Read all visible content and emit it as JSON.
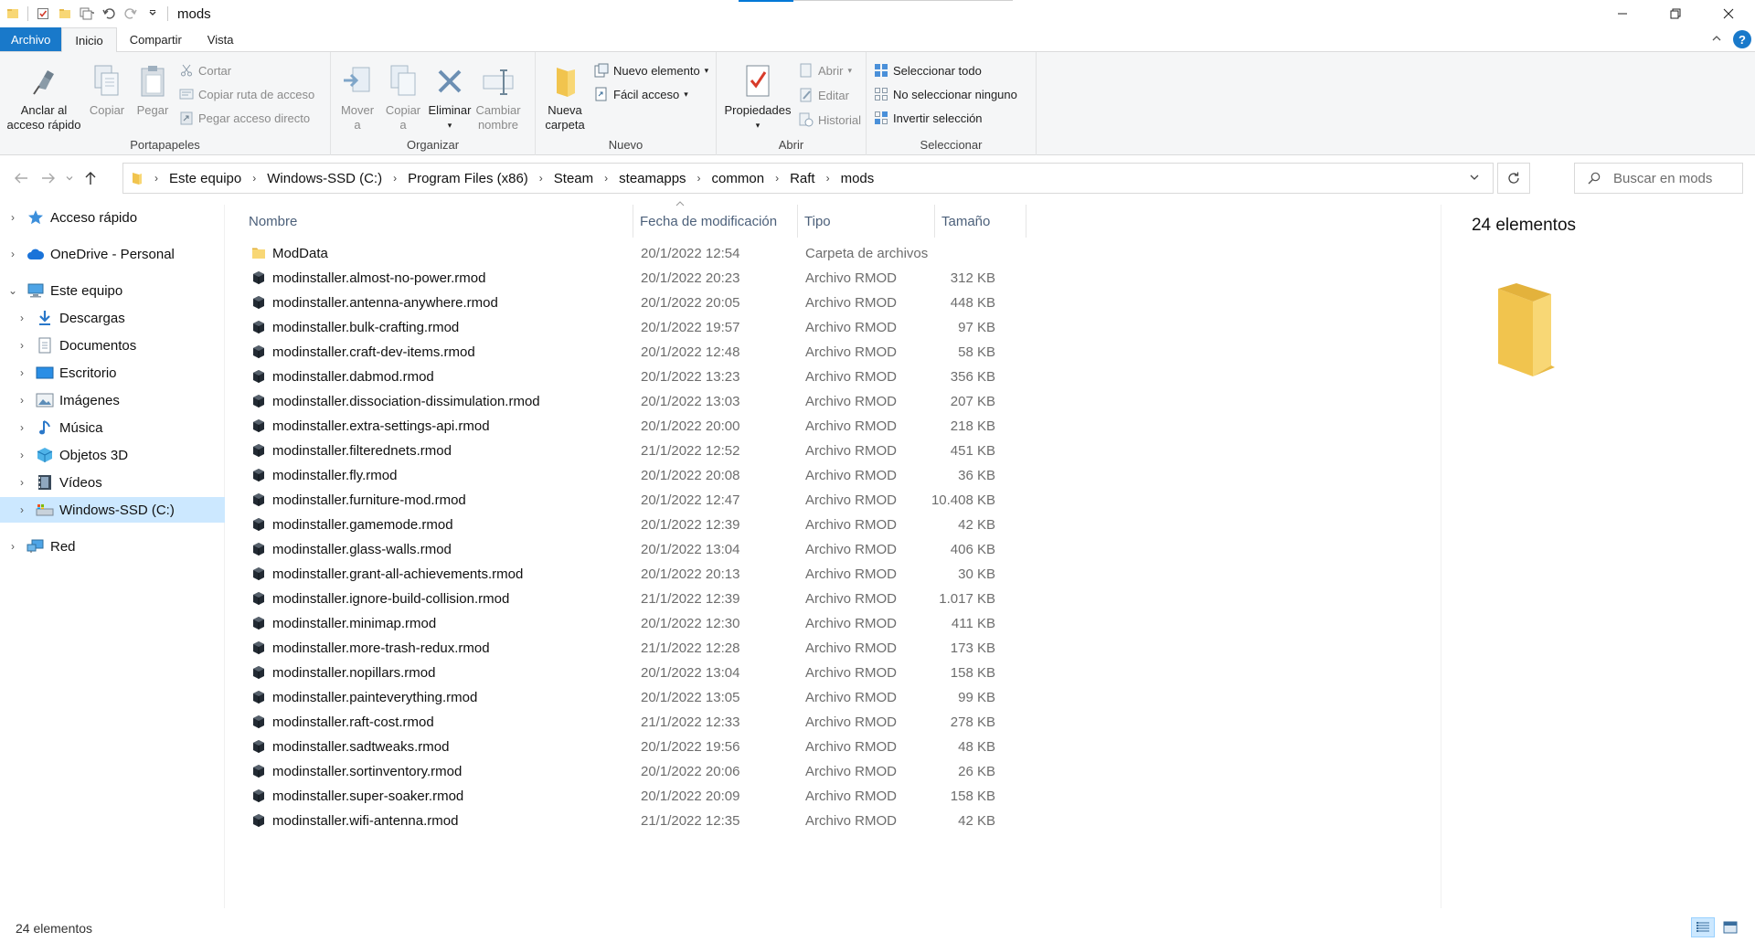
{
  "window": {
    "title": "mods",
    "controls": [
      "minimize-icon",
      "restore-icon",
      "close-icon"
    ]
  },
  "tabs": {
    "file": "Archivo",
    "home": "Inicio",
    "share": "Compartir",
    "view": "Vista"
  },
  "ribbon": {
    "portapapeles": {
      "label": "Portapapeles",
      "pin": "Anclar al acceso rápido",
      "pin_line1": "Anclar al",
      "pin_line2": "acceso rápido",
      "copy": "Copiar",
      "paste": "Pegar",
      "cut": "Cortar",
      "copy_path": "Copiar ruta de acceso",
      "paste_shortcut": "Pegar acceso directo"
    },
    "organizar": {
      "label": "Organizar",
      "move_line1": "Mover",
      "move_line2": "a",
      "copy_line1": "Copiar",
      "copy_line2": "a",
      "delete": "Eliminar",
      "rename_line1": "Cambiar",
      "rename_line2": "nombre"
    },
    "nuevo": {
      "label": "Nuevo",
      "new_folder_line1": "Nueva",
      "new_folder_line2": "carpeta",
      "new_item": "Nuevo elemento",
      "easy_access": "Fácil acceso"
    },
    "abrir": {
      "label": "Abrir",
      "properties": "Propiedades",
      "open": "Abrir",
      "edit": "Editar",
      "history": "Historial"
    },
    "seleccionar": {
      "label": "Seleccionar",
      "select_all": "Seleccionar todo",
      "select_none": "No seleccionar ninguno",
      "invert": "Invertir selección"
    }
  },
  "address": {
    "crumbs": [
      "Este equipo",
      "Windows-SSD (C:)",
      "Program Files (x86)",
      "Steam",
      "steamapps",
      "common",
      "Raft",
      "mods"
    ],
    "search_placeholder": "Buscar en mods"
  },
  "nav": {
    "items": [
      {
        "label": "Acceso rápido",
        "icon": "star-icon"
      },
      {
        "label": "OneDrive - Personal",
        "icon": "cloud-icon"
      },
      {
        "label": "Este equipo",
        "icon": "computer-icon"
      },
      {
        "label": "Descargas",
        "icon": "download-icon"
      },
      {
        "label": "Documentos",
        "icon": "document-icon"
      },
      {
        "label": "Escritorio",
        "icon": "desktop-icon"
      },
      {
        "label": "Imágenes",
        "icon": "images-icon"
      },
      {
        "label": "Música",
        "icon": "music-icon"
      },
      {
        "label": "Objetos 3D",
        "icon": "cube-icon"
      },
      {
        "label": "Vídeos",
        "icon": "video-icon"
      },
      {
        "label": "Windows-SSD (C:)",
        "icon": "drive-icon"
      },
      {
        "label": "Red",
        "icon": "network-icon"
      }
    ]
  },
  "columns": {
    "name": "Nombre",
    "date": "Fecha de modificación",
    "type": "Tipo",
    "size": "Tamaño"
  },
  "files": [
    {
      "name": "ModData",
      "date": "20/1/2022 12:54",
      "type": "Carpeta de archivos",
      "size": "",
      "icon": "folder-icon"
    },
    {
      "name": "modinstaller.almost-no-power.rmod",
      "date": "20/1/2022 20:23",
      "type": "Archivo RMOD",
      "size": "312 KB",
      "icon": "rmod-file-icon"
    },
    {
      "name": "modinstaller.antenna-anywhere.rmod",
      "date": "20/1/2022 20:05",
      "type": "Archivo RMOD",
      "size": "448 KB",
      "icon": "rmod-file-icon"
    },
    {
      "name": "modinstaller.bulk-crafting.rmod",
      "date": "20/1/2022 19:57",
      "type": "Archivo RMOD",
      "size": "97 KB",
      "icon": "rmod-file-icon"
    },
    {
      "name": "modinstaller.craft-dev-items.rmod",
      "date": "20/1/2022 12:48",
      "type": "Archivo RMOD",
      "size": "58 KB",
      "icon": "rmod-file-icon"
    },
    {
      "name": "modinstaller.dabmod.rmod",
      "date": "20/1/2022 13:23",
      "type": "Archivo RMOD",
      "size": "356 KB",
      "icon": "rmod-file-icon"
    },
    {
      "name": "modinstaller.dissociation-dissimulation.rmod",
      "date": "20/1/2022 13:03",
      "type": "Archivo RMOD",
      "size": "207 KB",
      "icon": "rmod-file-icon"
    },
    {
      "name": "modinstaller.extra-settings-api.rmod",
      "date": "20/1/2022 20:00",
      "type": "Archivo RMOD",
      "size": "218 KB",
      "icon": "rmod-file-icon"
    },
    {
      "name": "modinstaller.filterednets.rmod",
      "date": "21/1/2022 12:52",
      "type": "Archivo RMOD",
      "size": "451 KB",
      "icon": "rmod-file-icon"
    },
    {
      "name": "modinstaller.fly.rmod",
      "date": "20/1/2022 20:08",
      "type": "Archivo RMOD",
      "size": "36 KB",
      "icon": "rmod-file-icon"
    },
    {
      "name": "modinstaller.furniture-mod.rmod",
      "date": "20/1/2022 12:47",
      "type": "Archivo RMOD",
      "size": "10.408 KB",
      "icon": "rmod-file-icon"
    },
    {
      "name": "modinstaller.gamemode.rmod",
      "date": "20/1/2022 12:39",
      "type": "Archivo RMOD",
      "size": "42 KB",
      "icon": "rmod-file-icon"
    },
    {
      "name": "modinstaller.glass-walls.rmod",
      "date": "20/1/2022 13:04",
      "type": "Archivo RMOD",
      "size": "406 KB",
      "icon": "rmod-file-icon"
    },
    {
      "name": "modinstaller.grant-all-achievements.rmod",
      "date": "20/1/2022 20:13",
      "type": "Archivo RMOD",
      "size": "30 KB",
      "icon": "rmod-file-icon"
    },
    {
      "name": "modinstaller.ignore-build-collision.rmod",
      "date": "21/1/2022 12:39",
      "type": "Archivo RMOD",
      "size": "1.017 KB",
      "icon": "rmod-file-icon"
    },
    {
      "name": "modinstaller.minimap.rmod",
      "date": "20/1/2022 12:30",
      "type": "Archivo RMOD",
      "size": "411 KB",
      "icon": "rmod-file-icon"
    },
    {
      "name": "modinstaller.more-trash-redux.rmod",
      "date": "21/1/2022 12:28",
      "type": "Archivo RMOD",
      "size": "173 KB",
      "icon": "rmod-file-icon"
    },
    {
      "name": "modinstaller.nopillars.rmod",
      "date": "20/1/2022 13:04",
      "type": "Archivo RMOD",
      "size": "158 KB",
      "icon": "rmod-file-icon"
    },
    {
      "name": "modinstaller.painteverything.rmod",
      "date": "20/1/2022 13:05",
      "type": "Archivo RMOD",
      "size": "99 KB",
      "icon": "rmod-file-icon"
    },
    {
      "name": "modinstaller.raft-cost.rmod",
      "date": "21/1/2022 12:33",
      "type": "Archivo RMOD",
      "size": "278 KB",
      "icon": "rmod-file-icon"
    },
    {
      "name": "modinstaller.sadtweaks.rmod",
      "date": "20/1/2022 19:56",
      "type": "Archivo RMOD",
      "size": "48 KB",
      "icon": "rmod-file-icon"
    },
    {
      "name": "modinstaller.sortinventory.rmod",
      "date": "20/1/2022 20:06",
      "type": "Archivo RMOD",
      "size": "26 KB",
      "icon": "rmod-file-icon"
    },
    {
      "name": "modinstaller.super-soaker.rmod",
      "date": "20/1/2022 20:09",
      "type": "Archivo RMOD",
      "size": "158 KB",
      "icon": "rmod-file-icon"
    },
    {
      "name": "modinstaller.wifi-antenna.rmod",
      "date": "21/1/2022 12:35",
      "type": "Archivo RMOD",
      "size": "42 KB",
      "icon": "rmod-file-icon"
    }
  ],
  "preview": {
    "count": "24 elementos"
  },
  "status": {
    "count": "24 elementos"
  },
  "colors": {
    "accent": "#0078d7",
    "file_tab": "#1979ca",
    "selection": "#cce8ff",
    "folder_yellow": "#f8d775"
  }
}
